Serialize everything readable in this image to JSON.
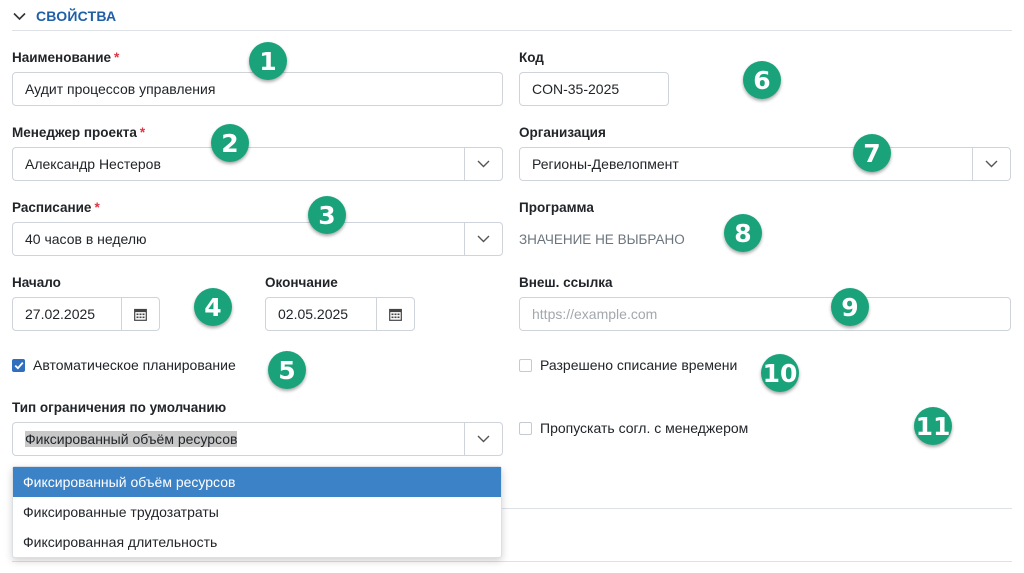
{
  "section": {
    "title": "СВОЙСТВА"
  },
  "fields": {
    "name": {
      "label": "Наименование",
      "required": "*",
      "value": "Аудит процессов управления"
    },
    "code": {
      "label": "Код",
      "value": "CON-35-2025"
    },
    "manager": {
      "label": "Менеджер проекта",
      "required": "*",
      "value": "Александр Нестеров"
    },
    "organization": {
      "label": "Организация",
      "value": "Регионы-Девелопмент"
    },
    "schedule": {
      "label": "Расписание",
      "required": "*",
      "value": "40 часов в неделю"
    },
    "program": {
      "label": "Программа",
      "value": "ЗНАЧЕНИЕ НЕ ВЫБРАНО"
    },
    "start": {
      "label": "Начало",
      "value": "27.02.2025"
    },
    "end": {
      "label": "Окончание",
      "value": "02.05.2025"
    },
    "external_link": {
      "label": "Внеш. ссылка",
      "placeholder": "https://example.com"
    },
    "auto_planning": {
      "label": "Автоматическое планирование",
      "checked": true
    },
    "time_writeoff": {
      "label": "Разрешено списание времени",
      "checked": false
    },
    "skip_approval": {
      "label": "Пропускать согл. с менеджером",
      "checked": false
    },
    "constraint_type": {
      "label": "Тип ограничения по умолчанию",
      "value": "Фиксированный объём ресурсов",
      "options": [
        "Фиксированный объём ресурсов",
        "Фиксированные трудозатраты",
        "Фиксированная длительность"
      ]
    }
  },
  "badges": [
    "1",
    "2",
    "3",
    "4",
    "5",
    "6",
    "7",
    "8",
    "9",
    "10",
    "11"
  ],
  "colors": {
    "accent": "#1f5fa8",
    "badge": "#1aa37a",
    "selected": "#3b82c6",
    "required": "#dc3545"
  },
  "icons": {
    "collapse": "chevron-down-icon",
    "select": "chevron-down-icon",
    "date": "calendar-icon",
    "check": "check-icon"
  }
}
